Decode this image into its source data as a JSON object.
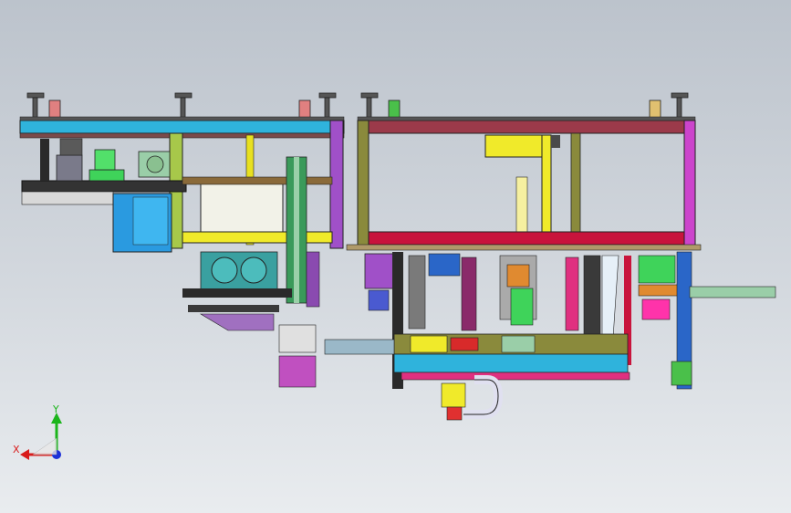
{
  "viewport": {
    "background_top": "#bcc3cc",
    "background_bottom": "#e9ecef"
  },
  "triad": {
    "x_label": "X",
    "y_label": "Y",
    "x_color": "#d81b1b",
    "y_color": "#1bb51b",
    "z_color": "#1b2fd8"
  },
  "model": {
    "description_icon": "cad-assembly-machine",
    "colors": {
      "frame_blue": "#2fb3dc",
      "frame_maroon": "#9b3a4a",
      "frame_olive": "#8a8a3c",
      "frame_magenta": "#cc44cc",
      "yellow": "#f0ea2a",
      "green": "#3fd35a",
      "dark": "#1c1c1c",
      "red": "#e03030",
      "crimson": "#c8143c",
      "pink": "#ff33aa",
      "violet": "#a050c8",
      "cyan": "#58d6e8",
      "teal": "#3aa0a0",
      "gray": "#8c8c8c"
    }
  }
}
